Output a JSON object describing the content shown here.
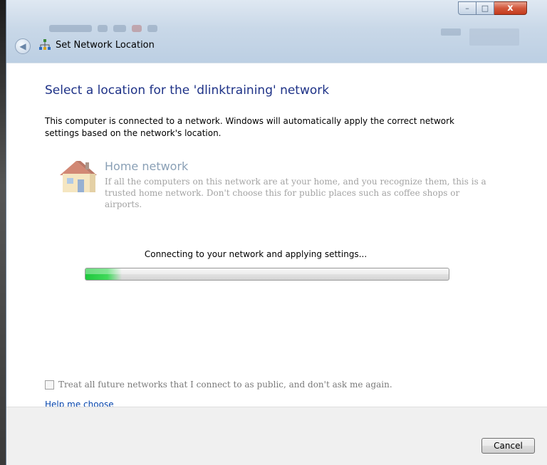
{
  "window": {
    "title": "Set Network Location",
    "controls": {
      "minimize": "–",
      "maximize": "□",
      "close": "x"
    }
  },
  "main": {
    "heading": "Select a location for the 'dlinktraining' network",
    "description": "This computer is connected to a network. Windows will automatically apply the correct network settings based on the network's location.",
    "option": {
      "icon": "house-icon",
      "title": "Home network",
      "description": "If all the computers on this network are at your home, and you recognize them, this is a trusted home network.  Don't choose this for public places such as coffee shops or airports."
    },
    "status": "Connecting to your network and applying settings...",
    "progress": {
      "fraction": 0.1,
      "color": "#2ed14a"
    },
    "checkbox": {
      "label": "Treat all future networks that I connect to as public, and don't ask me again.",
      "checked": false
    },
    "help_link": "Help me choose"
  },
  "footer": {
    "cancel_label": "Cancel"
  },
  "colors": {
    "heading": "#1e3287",
    "link": "#0645ad",
    "close_button": "#c43b1d"
  }
}
